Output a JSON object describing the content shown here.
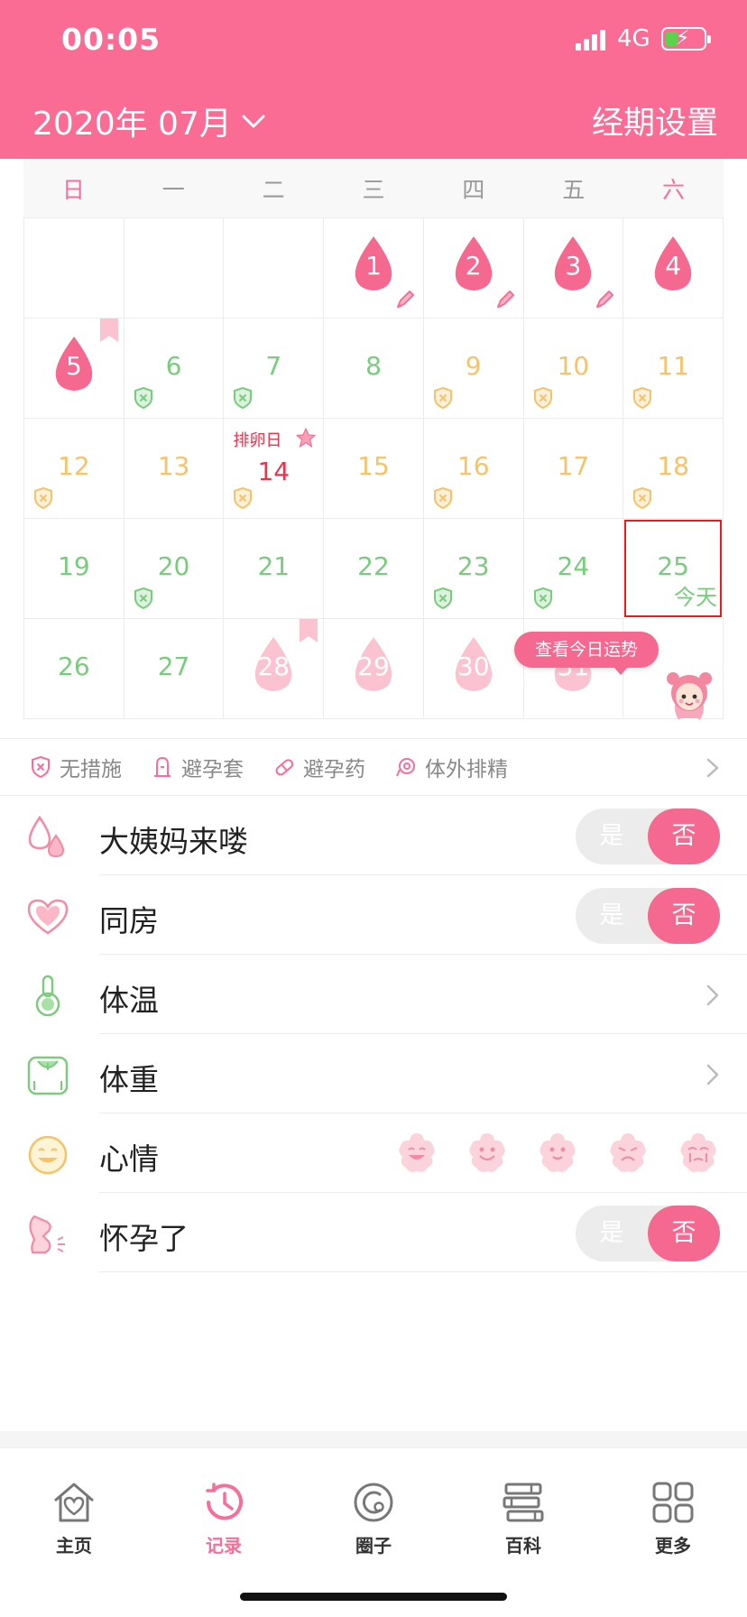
{
  "status_bar": {
    "time": "00:05",
    "network": "4G"
  },
  "header": {
    "month_label": "2020年 07月",
    "settings_label": "经期设置"
  },
  "calendar": {
    "weekdays": [
      "日",
      "一",
      "二",
      "三",
      "四",
      "五",
      "六"
    ],
    "weekend_color": "#f56f99",
    "weeks": [
      [
        {
          "day": ""
        },
        {
          "day": ""
        },
        {
          "day": ""
        },
        {
          "day": "1",
          "type": "period",
          "mark": "pencil"
        },
        {
          "day": "2",
          "type": "period",
          "mark": "pencil"
        },
        {
          "day": "3",
          "type": "period",
          "mark": "pencil"
        },
        {
          "day": "4",
          "type": "period"
        }
      ],
      [
        {
          "day": "5",
          "type": "period",
          "bookmark": true
        },
        {
          "day": "6",
          "type": "safe",
          "shield": "green"
        },
        {
          "day": "7",
          "type": "safe",
          "shield": "green"
        },
        {
          "day": "8",
          "type": "safe"
        },
        {
          "day": "9",
          "type": "fertile",
          "shield": "yellow"
        },
        {
          "day": "10",
          "type": "fertile",
          "shield": "yellow"
        },
        {
          "day": "11",
          "type": "fertile",
          "shield": "yellow"
        }
      ],
      [
        {
          "day": "12",
          "type": "fertile",
          "shield": "yellow"
        },
        {
          "day": "13",
          "type": "fertile"
        },
        {
          "day": "14",
          "type": "ovulation",
          "shield": "yellow",
          "label": "排卵日"
        },
        {
          "day": "15",
          "type": "fertile"
        },
        {
          "day": "16",
          "type": "fertile",
          "shield": "yellow"
        },
        {
          "day": "17",
          "type": "fertile"
        },
        {
          "day": "18",
          "type": "fertile",
          "shield": "yellow"
        }
      ],
      [
        {
          "day": "19",
          "type": "safe"
        },
        {
          "day": "20",
          "type": "safe",
          "shield": "green"
        },
        {
          "day": "21",
          "type": "safe"
        },
        {
          "day": "22",
          "type": "safe"
        },
        {
          "day": "23",
          "type": "safe",
          "shield": "green"
        },
        {
          "day": "24",
          "type": "safe",
          "shield": "green"
        },
        {
          "day": "25",
          "type": "safe",
          "today": true,
          "today_label": "今天"
        }
      ],
      [
        {
          "day": "26",
          "type": "safe"
        },
        {
          "day": "27",
          "type": "safe"
        },
        {
          "day": "28",
          "type": "predicted",
          "bookmark": true
        },
        {
          "day": "29",
          "type": "predicted"
        },
        {
          "day": "30",
          "type": "predicted"
        },
        {
          "day": "31",
          "type": "predicted"
        },
        {
          "day": ""
        }
      ]
    ],
    "colors": {
      "period": "#f5688f",
      "predicted": "#fbc3d2",
      "safe": "#79cc7d",
      "fertile": "#f4c36a",
      "ovulation": "#e5354e",
      "today_border": "#e02020"
    }
  },
  "fortune_button": "查看今日运势",
  "legend": {
    "items": [
      {
        "label": "无措施",
        "icon": "shield-x-icon"
      },
      {
        "label": "避孕套",
        "icon": "condom-icon"
      },
      {
        "label": "避孕药",
        "icon": "pill-icon"
      },
      {
        "label": "体外排精",
        "icon": "swirl-icon"
      }
    ]
  },
  "records": {
    "period": {
      "label": "大姨妈来喽",
      "yes": "是",
      "no": "否",
      "value": "否"
    },
    "intimacy": {
      "label": "同房",
      "yes": "是",
      "no": "否",
      "value": "否"
    },
    "temperature": {
      "label": "体温"
    },
    "weight": {
      "label": "体重"
    },
    "mood": {
      "label": "心情",
      "options": [
        "happy-face-icon",
        "smile-face-icon",
        "calm-face-icon",
        "sad-face-icon",
        "cry-face-icon"
      ]
    },
    "pregnant": {
      "label": "怀孕了",
      "yes": "是",
      "no": "否",
      "value": "否"
    }
  },
  "tabbar": {
    "items": [
      {
        "label": "主页",
        "icon": "home-heart-icon"
      },
      {
        "label": "记录",
        "icon": "clock-icon",
        "active": true
      },
      {
        "label": "圈子",
        "icon": "circle-icon"
      },
      {
        "label": "百科",
        "icon": "books-icon"
      },
      {
        "label": "更多",
        "icon": "grid-icon"
      }
    ]
  }
}
